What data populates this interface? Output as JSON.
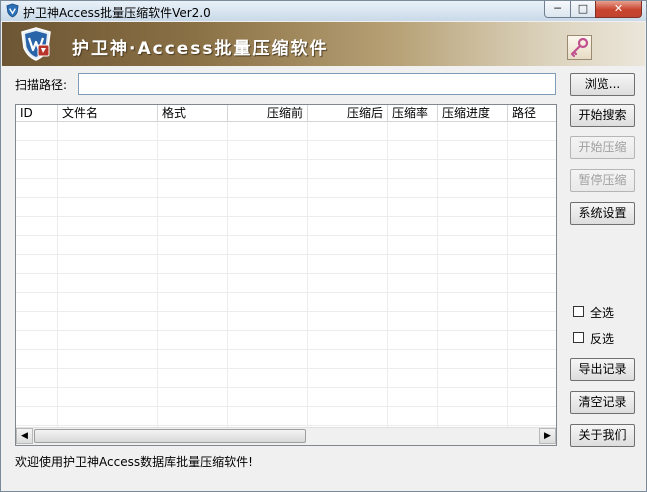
{
  "window": {
    "title": "护卫神Access批量压缩软件Ver2.0",
    "controls": {
      "minimize": "─",
      "maximize": "□",
      "close": "✕"
    }
  },
  "banner": {
    "title": "护卫神·Access批量压缩软件",
    "logo_icon": "shield-logo-icon",
    "key_icon": "key-icon"
  },
  "scan": {
    "label": "扫描路径:",
    "value": "",
    "browse_label": "浏览..."
  },
  "list": {
    "columns": [
      "ID",
      "文件名",
      "格式",
      "压缩前",
      "压缩后",
      "压缩率",
      "压缩进度",
      "路径"
    ],
    "rows": []
  },
  "actions": {
    "start_search": "开始搜索",
    "start_compress": "开始压缩",
    "pause_compress": "暂停压缩",
    "system_settings": "系统设置",
    "select_all": "全选",
    "invert_select": "反选",
    "export_log": "导出记录",
    "clear_log": "清空记录",
    "about_us": "关于我们"
  },
  "status": {
    "message": "欢迎使用护卫神Access数据库批量压缩软件!"
  },
  "colors": {
    "banner_dark": "#6d5634",
    "banner_light": "#ebe6da",
    "disabled_text": "#a0a0a0"
  }
}
